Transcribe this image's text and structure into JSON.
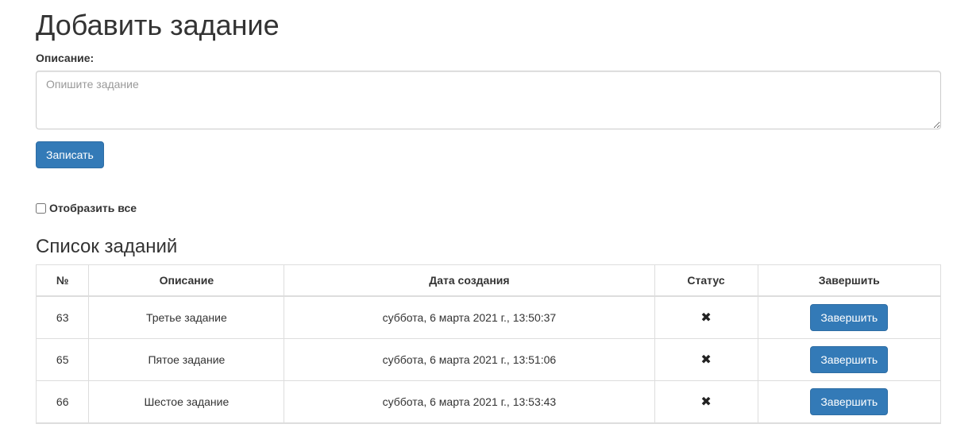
{
  "header": {
    "title": "Добавить задание"
  },
  "form": {
    "description_label": "Описание:",
    "description_placeholder": "Опишите задание",
    "description_value": "",
    "submit_label": "Записать"
  },
  "filter": {
    "show_all_label": "Отобразить все",
    "show_all_checked": false
  },
  "tasks": {
    "title": "Список заданий",
    "columns": [
      "№",
      "Описание",
      "Дата создания",
      "Статус",
      "Завершить"
    ],
    "rows": [
      {
        "id": "63",
        "description": "Третье задание",
        "created": "суббота, 6 марта 2021 г., 13:50:37",
        "status": "✖",
        "status_icon": "cross-icon",
        "action_label": "Завершить"
      },
      {
        "id": "65",
        "description": "Пятое задание",
        "created": "суббота, 6 марта 2021 г., 13:51:06",
        "status": "✖",
        "status_icon": "cross-icon",
        "action_label": "Завершить"
      },
      {
        "id": "66",
        "description": "Шестое задание",
        "created": "суббота, 6 марта 2021 г., 13:53:43",
        "status": "✖",
        "status_icon": "cross-icon",
        "action_label": "Завершить"
      }
    ]
  },
  "colors": {
    "primary": "#337ab7",
    "primary_border": "#2e6da4",
    "text": "#333333",
    "border": "#dddddd"
  }
}
